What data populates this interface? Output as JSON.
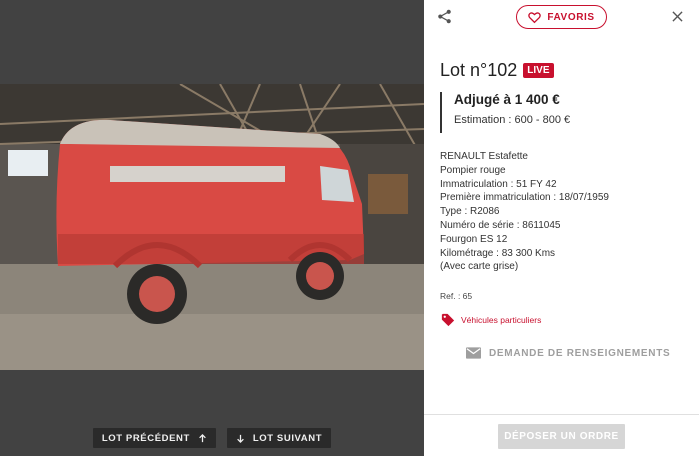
{
  "viewer": {
    "prev_label": "LOT PRÉCÉDENT",
    "next_label": "LOT SUIVANT"
  },
  "panel": {
    "favorites_label": "FAVORIS",
    "lot_title": "Lot n°102",
    "live_badge": "LIVE",
    "adjuge": "Adjugé à 1 400 €",
    "estimation": "Estimation : 600 - 800 €",
    "description": [
      "RENAULT Estafette",
      "Pompier rouge",
      "Immatriculation : 51 FY 42",
      "Première immatriculation : 18/07/1959",
      "Type : R2086",
      "Numéro de série : 8611045",
      "Fourgon ES 12",
      "Kilométrage : 83 300 Kms",
      "(Avec carte grise)"
    ],
    "ref": "Ref. : 65",
    "category": "Véhicules particuliers",
    "info_request": "DEMANDE DE RENSEIGNEMENTS",
    "order_button": "DÉPOSER UN ORDRE"
  },
  "colors": {
    "accent": "#c8102e",
    "viewer_bg": "#424242",
    "nav_button_bg": "#2a2a2a",
    "disabled_button": "#d6d6d6"
  },
  "icons": {
    "share": "share-icon",
    "favorite": "heart-icon",
    "close": "close-icon",
    "up": "arrow-up-icon",
    "down": "arrow-down-icon",
    "tag": "tag-icon",
    "mail": "mail-icon"
  }
}
